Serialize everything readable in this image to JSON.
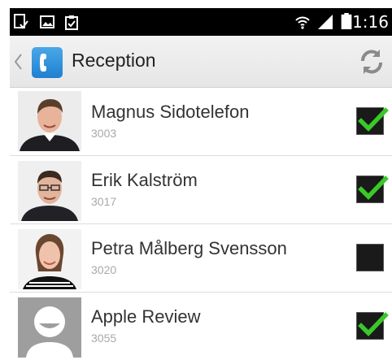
{
  "status_bar": {
    "time": "11:16",
    "icons": [
      "notification-icon",
      "image-icon",
      "clipboard-icon",
      "wifi-icon",
      "signal-icon",
      "battery-icon"
    ]
  },
  "action_bar": {
    "title": "Reception",
    "icons": [
      "back-chevron-icon",
      "phone-app-icon",
      "refresh-icon"
    ]
  },
  "contacts": [
    {
      "name": "Magnus Sidotelefon",
      "extension": "3003",
      "checked": true
    },
    {
      "name": "Erik Kalström",
      "extension": "3017",
      "checked": true
    },
    {
      "name": "Petra Målberg Svensson",
      "extension": "3020",
      "checked": false
    },
    {
      "name": "Apple Review",
      "extension": "3055",
      "checked": true
    }
  ],
  "colors": {
    "status_bar": "#000000",
    "check_green": "#39c928",
    "checkbox_fill": "#1a1a1a"
  }
}
